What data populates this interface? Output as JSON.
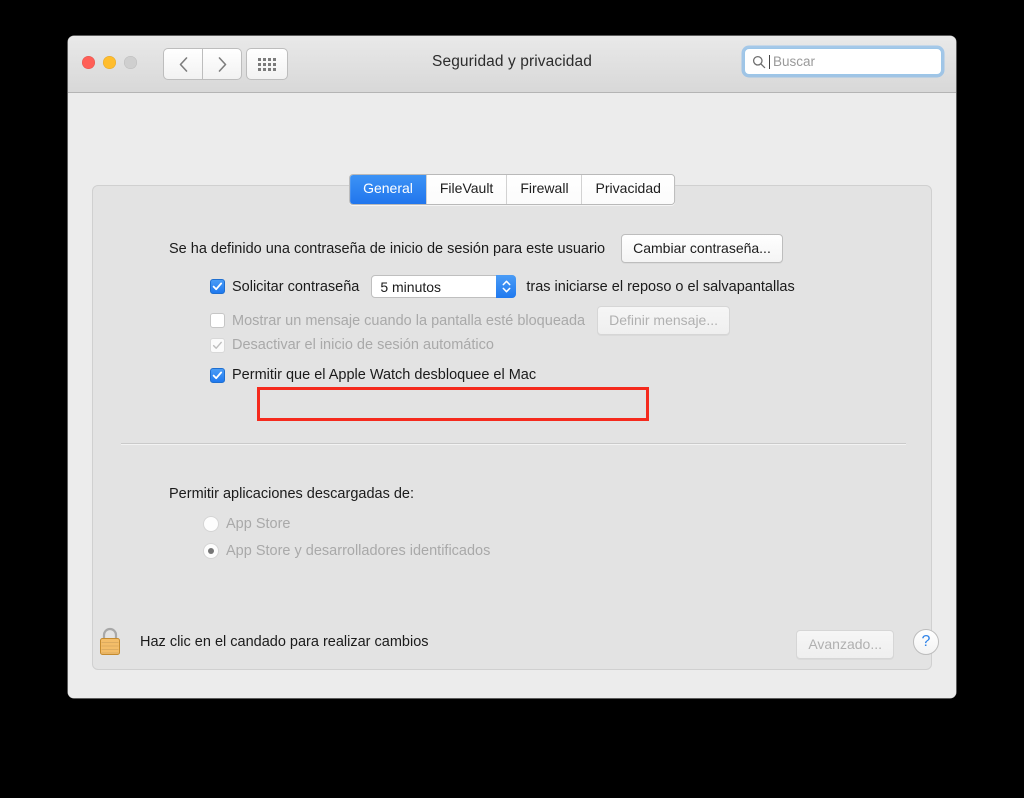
{
  "window": {
    "title": "Seguridad y privacidad",
    "traffic_lights": [
      "close",
      "minimize",
      "zoom"
    ],
    "nav": {
      "back": "‹",
      "forward": "›",
      "show_all": "grid-icon"
    },
    "search": {
      "placeholder": "Buscar",
      "value": ""
    }
  },
  "tabs": [
    {
      "label": "General",
      "active": true
    },
    {
      "label": "FileVault",
      "active": false
    },
    {
      "label": "Firewall",
      "active": false
    },
    {
      "label": "Privacidad",
      "active": false
    }
  ],
  "general": {
    "password_status": "Se ha definido una contraseña de inicio de sesión para este usuario",
    "change_password_button": "Cambiar contraseña...",
    "require_password": {
      "label": "Solicitar contraseña",
      "checked": true,
      "delay_value": "5 minutos",
      "suffix": "tras iniciarse el reposo o el salvapantallas"
    },
    "show_message": {
      "label": "Mostrar un mensaje cuando la pantalla esté bloqueada",
      "checked": false,
      "enabled": false,
      "button": "Definir mensaje..."
    },
    "disable_autologin": {
      "label": "Desactivar el inicio de sesión automático",
      "checked": true,
      "enabled": false
    },
    "apple_watch": {
      "label": "Permitir que el Apple Watch desbloquee el Mac",
      "checked": true,
      "enabled": true,
      "highlighted": true
    },
    "download_section": {
      "title": "Permitir aplicaciones descargadas de:",
      "options": [
        {
          "label": "App Store",
          "selected": false
        },
        {
          "label": "App Store y desarrolladores identificados",
          "selected": true
        }
      ]
    }
  },
  "footer": {
    "lock_text": "Haz clic en el candado para realizar cambios",
    "lock_state": "locked",
    "advanced_button": "Avanzado...",
    "help_button": "?"
  },
  "colors": {
    "accent_blue": "#2176ed",
    "highlight_red": "#f52a1d",
    "window_bg": "#ececec",
    "panel_bg": "#e3e3e3",
    "lock_gold": "#f0b252"
  }
}
